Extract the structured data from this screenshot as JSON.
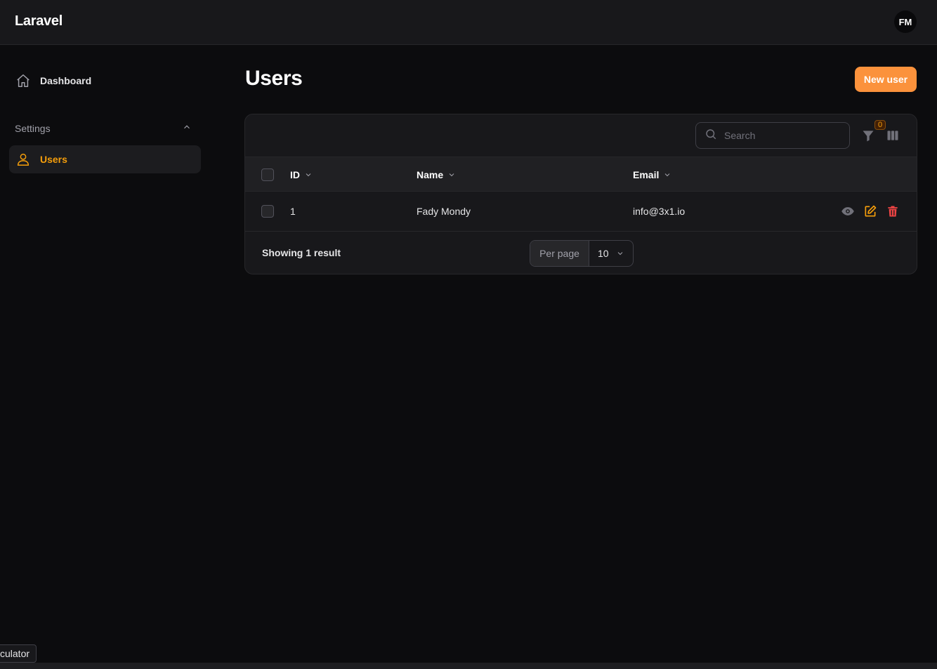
{
  "app": {
    "brand": "Laravel",
    "user_initials": "FM"
  },
  "sidebar": {
    "dashboard_label": "Dashboard",
    "group_label": "Settings",
    "users_label": "Users"
  },
  "page": {
    "title": "Users",
    "new_button": "New user"
  },
  "toolbar": {
    "search_placeholder": "Search",
    "filter_count": "0"
  },
  "table": {
    "columns": [
      "ID",
      "Name",
      "Email"
    ],
    "rows": [
      {
        "id": "1",
        "name": "Fady Mondy",
        "email": "info@3x1.io"
      }
    ]
  },
  "footer": {
    "showing": "Showing 1 result",
    "per_page_label": "Per page",
    "per_page_value": "10"
  },
  "tooltip": {
    "text": "culator"
  },
  "colors": {
    "accent": "#f59e0b",
    "button": "#fb923c",
    "danger": "#ef4444"
  }
}
